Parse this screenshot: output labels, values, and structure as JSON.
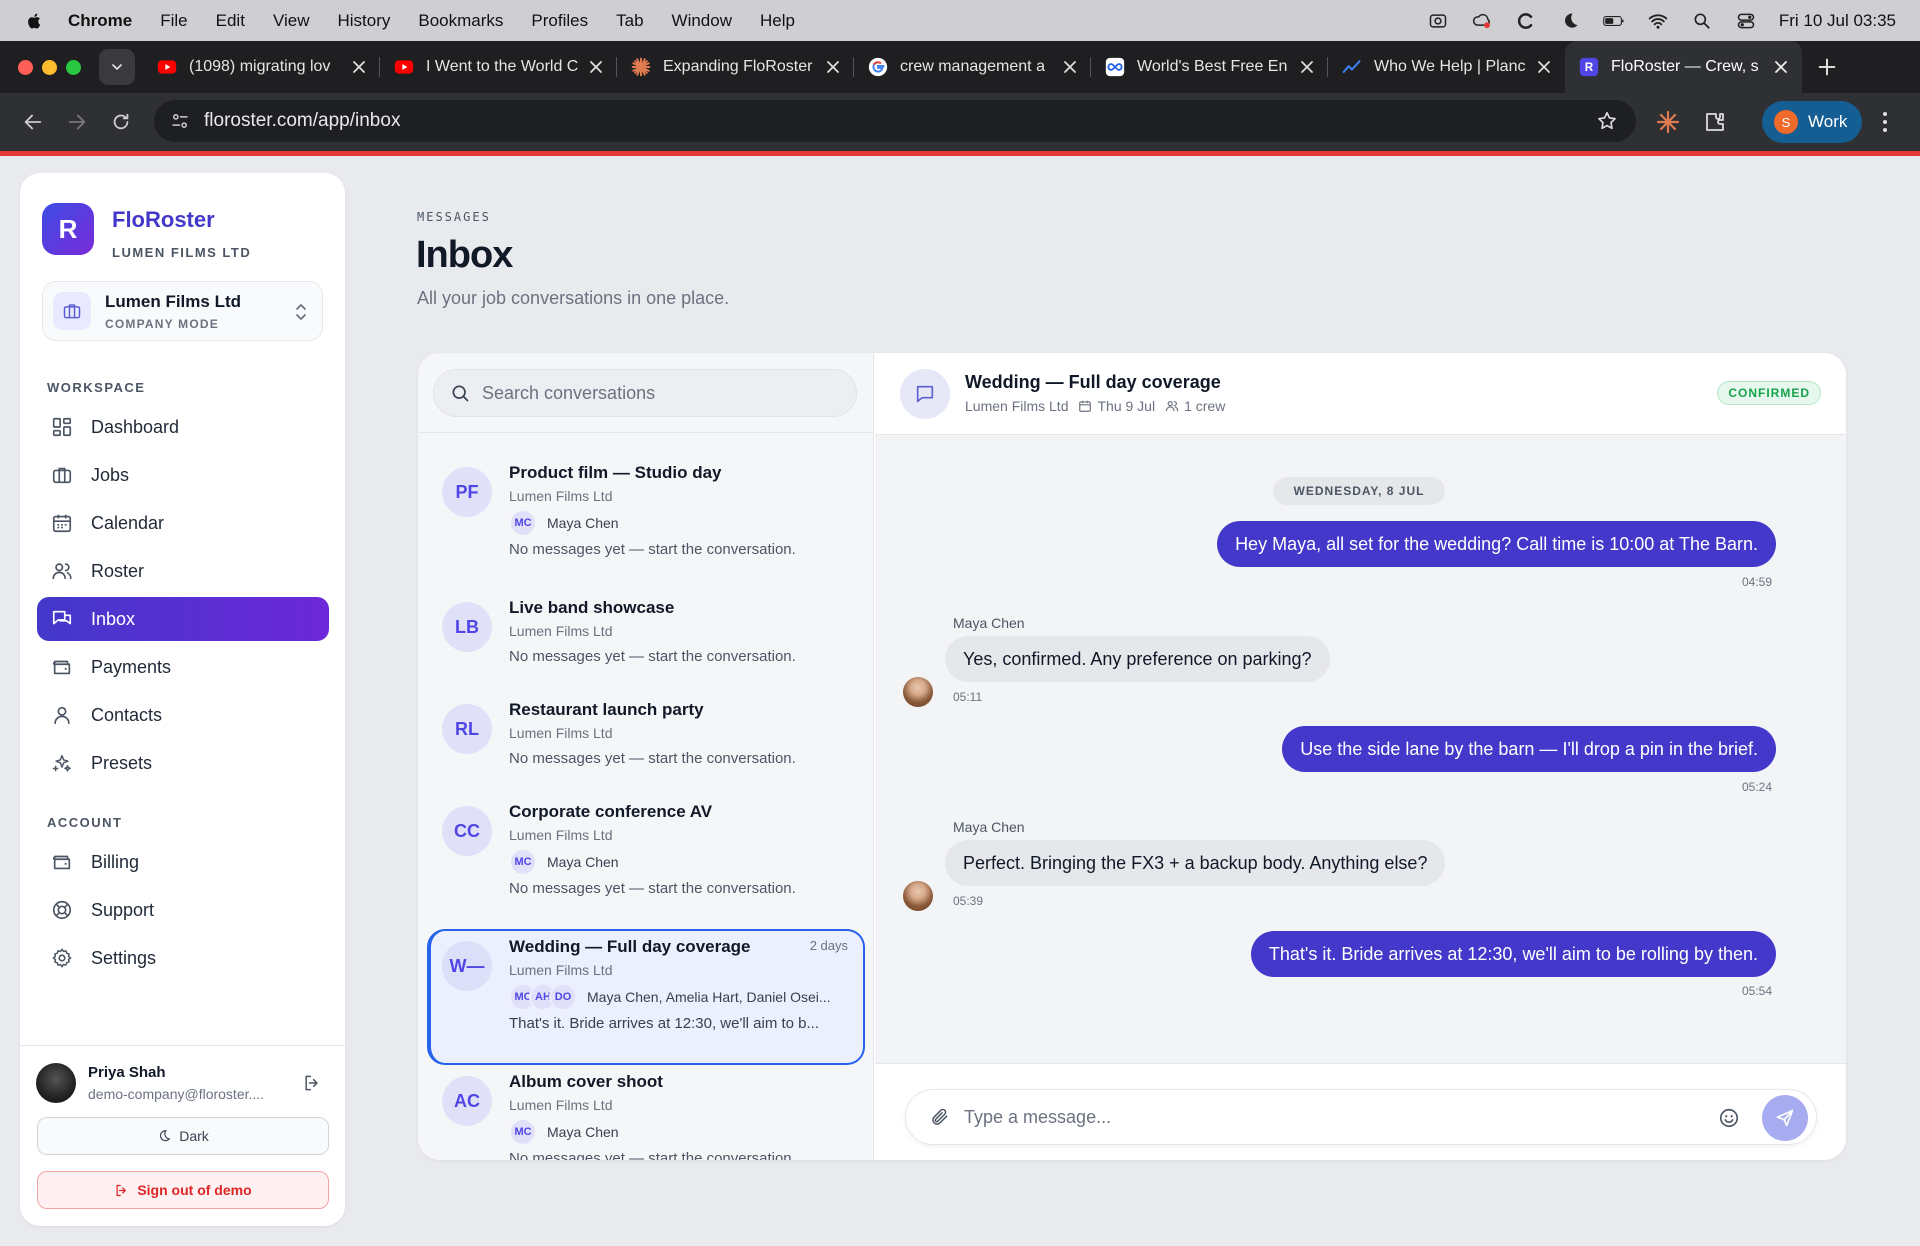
{
  "menubar": {
    "app": "Chrome",
    "items": [
      "File",
      "Edit",
      "View",
      "History",
      "Bookmarks",
      "Profiles",
      "Tab",
      "Window",
      "Help"
    ],
    "datetime": "Fri 10 Jul  03:35"
  },
  "tabs": [
    {
      "title": "(1098) migrating lov",
      "icon": "youtube-icon"
    },
    {
      "title": "I Went to the World C",
      "icon": "youtube-icon"
    },
    {
      "title": "Expanding FloRoster",
      "icon": "claude-icon"
    },
    {
      "title": "crew management a",
      "icon": "google-icon"
    },
    {
      "title": "World's Best Free En",
      "icon": "infinity-icon"
    },
    {
      "title": "Who We Help | Planc",
      "icon": "chart-line-icon"
    },
    {
      "title": "FloRoster — Crew, s",
      "icon": "floroster-icon"
    }
  ],
  "address": {
    "url": "floroster.com/app/inbox",
    "profile_initial": "S",
    "profile_label": "Work"
  },
  "colors": {
    "accent": "#4338ca",
    "accent2": "#6d28d9",
    "confirmed": "#16a34a",
    "danger": "#dc2626"
  },
  "sidebar": {
    "brand_logo": "R",
    "brand_name": "FloRoster",
    "brand_sub": "LUMEN FILMS LTD",
    "company_name": "Lumen Films Ltd",
    "company_mode": "COMPANY MODE",
    "workspace_label": "WORKSPACE",
    "workspace_items": [
      "Dashboard",
      "Jobs",
      "Calendar",
      "Roster",
      "Inbox",
      "Payments",
      "Contacts",
      "Presets"
    ],
    "account_label": "ACCOUNT",
    "account_items": [
      "Billing",
      "Support",
      "Settings"
    ],
    "user_name": "Priya Shah",
    "user_email": "demo-company@floroster....",
    "dark_label": "Dark",
    "signout_label": "Sign out of demo"
  },
  "header": {
    "eyebrow": "MESSAGES",
    "title": "Inbox",
    "subtitle": "All your job conversations in one place."
  },
  "search": {
    "placeholder": "Search conversations"
  },
  "conversations": [
    {
      "initials": "PF",
      "title": "Product film — Studio day",
      "company": "Lumen Films Ltd",
      "crew_chips": [
        "MC"
      ],
      "crew_names": "Maya Chen",
      "preview": "No messages yet — start the conversation.",
      "age": ""
    },
    {
      "initials": "LB",
      "title": "Live band showcase",
      "company": "Lumen Films Ltd",
      "crew_chips": [],
      "crew_names": "",
      "preview": "No messages yet — start the conversation.",
      "age": ""
    },
    {
      "initials": "RL",
      "title": "Restaurant launch party",
      "company": "Lumen Films Ltd",
      "crew_chips": [],
      "crew_names": "",
      "preview": "No messages yet — start the conversation.",
      "age": ""
    },
    {
      "initials": "CC",
      "title": "Corporate conference AV",
      "company": "Lumen Films Ltd",
      "crew_chips": [
        "MC"
      ],
      "crew_names": "Maya Chen",
      "preview": "No messages yet — start the conversation.",
      "age": ""
    },
    {
      "initials": "W—",
      "title": "Wedding — Full day coverage",
      "company": "Lumen Films Ltd",
      "crew_chips": [
        "MC",
        "AH",
        "DO"
      ],
      "crew_names": "Maya Chen, Amelia Hart, Daniel Osei...",
      "preview": "That's it. Bride arrives at 12:30, we'll aim to b...",
      "age": "2 days"
    },
    {
      "initials": "AC",
      "title": "Album cover shoot",
      "company": "Lumen Films Ltd",
      "crew_chips": [
        "MC"
      ],
      "crew_names": "Maya Chen",
      "preview": "No messages yet — start the conversation.",
      "age": ""
    }
  ],
  "thread": {
    "title": "Wedding — Full day coverage",
    "company": "Lumen Films Ltd",
    "date": "Thu 9 Jul",
    "crew": "1 crew",
    "status": "CONFIRMED",
    "day_label": "WEDNESDAY, 8 JUL",
    "messages": [
      {
        "dir": "out",
        "text": "Hey Maya, all set for the wedding? Call time is 10:00 at The Barn.",
        "time": "04:59"
      },
      {
        "dir": "in",
        "sender": "Maya Chen",
        "text": "Yes, confirmed. Any preference on parking?",
        "time": "05:11"
      },
      {
        "dir": "out",
        "text": "Use the side lane by the barn — I'll drop a pin in the brief.",
        "time": "05:24"
      },
      {
        "dir": "in",
        "sender": "Maya Chen",
        "text": "Perfect. Bringing the FX3 + a backup body. Anything else?",
        "time": "05:39"
      },
      {
        "dir": "out",
        "text": "That's it. Bride arrives at 12:30, we'll aim to be rolling by then.",
        "time": "05:54"
      }
    ],
    "composer_placeholder": "Type a message..."
  }
}
